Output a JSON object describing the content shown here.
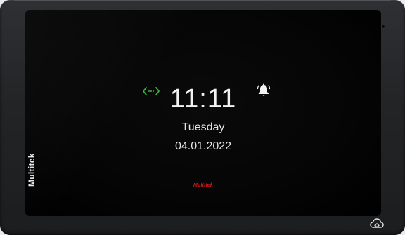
{
  "device": {
    "side_brand": "Multitek",
    "frame_color": "#252628"
  },
  "screen": {
    "time": "11:11",
    "day": "Tuesday",
    "date": "04.01.2022",
    "brand": "Multitek",
    "brand_color": "#d21f1f",
    "connection_icon": "connection-arrows-icon",
    "connection_icon_color": "#3cb043",
    "alarm_icon": "bell-icon",
    "home_icon": "cloud-home-icon"
  }
}
